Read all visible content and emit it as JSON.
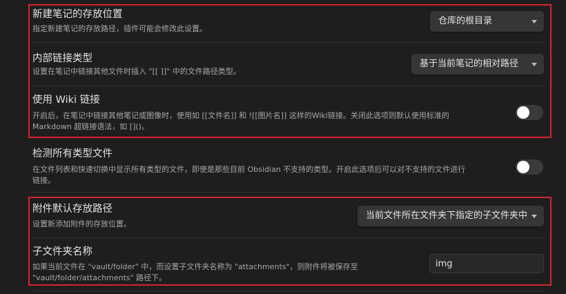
{
  "settings": [
    {
      "name": "新建笔记的存放位置",
      "desc": "指定新建笔记的存放路径，插件可能会修改此设置。",
      "control": "dropdown",
      "value": "仓库的根目录"
    },
    {
      "name": "内部链接类型",
      "desc": "设置在笔记中链接其他文件时插入 \"[[ ]]\" 中的文件路径类型。",
      "control": "dropdown",
      "value": "基于当前笔记的相对路径"
    },
    {
      "name": "使用 Wiki 链接",
      "desc_line1": "开启后，在笔记中链接其他笔记或图像时，使用如 [[文件名]] 和 ![[图片名]] 这样的Wiki链接。关闭此选项则默认使用标准的",
      "desc_line2": "Markdown 超链接语法，如 []()。",
      "control": "toggle",
      "enabled": false
    },
    {
      "name": "检测所有类型文件",
      "desc_line1": "在文件列表和快速切换中显示所有类型的文件，即使是那些目前 Obsidian 不支持的类型。开启此选项后可以对不支持的文件进行",
      "desc_line2": "链接。",
      "control": "toggle",
      "enabled": false
    },
    {
      "name": "附件默认存放路径",
      "desc": "设置新添加附件的存放位置。",
      "control": "dropdown",
      "value": "当前文件所在文件夹下指定的子文件夹中"
    },
    {
      "name": "子文件夹名称",
      "desc_line1": "如果当前文件在 \"vault/folder\" 中，而设置子文件夹名称为 \"attachments\"，则附件将被保存至",
      "desc_line2": "\"vault/folder/attachments\" 路径下。",
      "control": "text",
      "value": "img"
    }
  ],
  "colors": {
    "background": "#1e1e1e",
    "highlight_border": "#d9232e",
    "control_bg": "#363636"
  }
}
